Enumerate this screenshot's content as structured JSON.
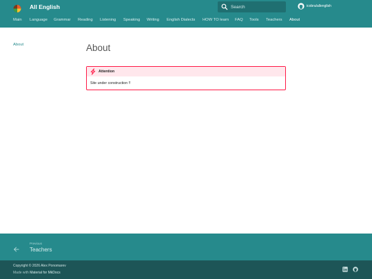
{
  "header": {
    "site_title": "All English",
    "search_placeholder": "Search",
    "repo_label": "icobra/allenglish"
  },
  "tabs": [
    {
      "label": "Main"
    },
    {
      "label": "Language"
    },
    {
      "label": "Grammar"
    },
    {
      "label": "Reading"
    },
    {
      "label": "Listening"
    },
    {
      "label": "Speaking"
    },
    {
      "label": "Writing"
    },
    {
      "label": "English Dialects"
    },
    {
      "label": "HOW TO learn"
    },
    {
      "label": "FAQ"
    },
    {
      "label": "Tools"
    },
    {
      "label": "Teachers"
    },
    {
      "label": "About"
    }
  ],
  "active_tab": "About",
  "sidebar": {
    "active_item": "About"
  },
  "main": {
    "title": "About",
    "admonition": {
      "title": "Attention",
      "body": "Site under construction !!"
    }
  },
  "footer": {
    "prev_caption": "Previous",
    "prev_title": "Teachers",
    "copyright": "Copyright © 2026 Alex Ponomarev",
    "made_with_prefix": "Made with ",
    "made_with_link": "Material for MkDocs"
  },
  "colors": {
    "primary": "#268a8c",
    "footer_dark": "#1d5557",
    "danger": "#ff1744"
  },
  "icons": {
    "logo": "logo-icon",
    "search": "search-icon",
    "repo": "github-icon",
    "admonition": "danger-bolt-icon",
    "prev": "arrow-left-icon",
    "social": [
      "linkedin-icon",
      "github-icon"
    ]
  }
}
